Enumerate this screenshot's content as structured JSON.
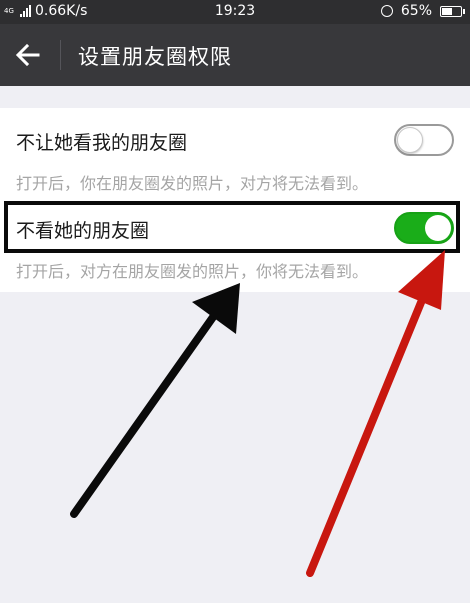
{
  "status_bar": {
    "network_tag": "4G",
    "speed": "0.66K/s",
    "time": "19:23",
    "alarm_icon": "alarm-icon",
    "battery_level": "65%",
    "battery_fraction": 0.65
  },
  "header": {
    "back_icon": "arrow-left-icon",
    "title": "设置朋友圈权限"
  },
  "settings": {
    "hide_mine": {
      "label": "不让她看我的朋友圈",
      "description": "打开后，你在朋友圈发的照片，对方将无法看到。",
      "enabled": false
    },
    "hide_hers": {
      "label": "不看她的朋友圈",
      "description": "打开后，对方在朋友圈发的照片，你将无法看到。",
      "enabled": true
    }
  },
  "colors": {
    "status_bar": "#2e2e30",
    "title_bar": "#38383b",
    "switch_on": "#1aad19",
    "page_background": "#efeff4",
    "annotation_black": "#0a0a0a",
    "annotation_red": "#c8170f"
  }
}
